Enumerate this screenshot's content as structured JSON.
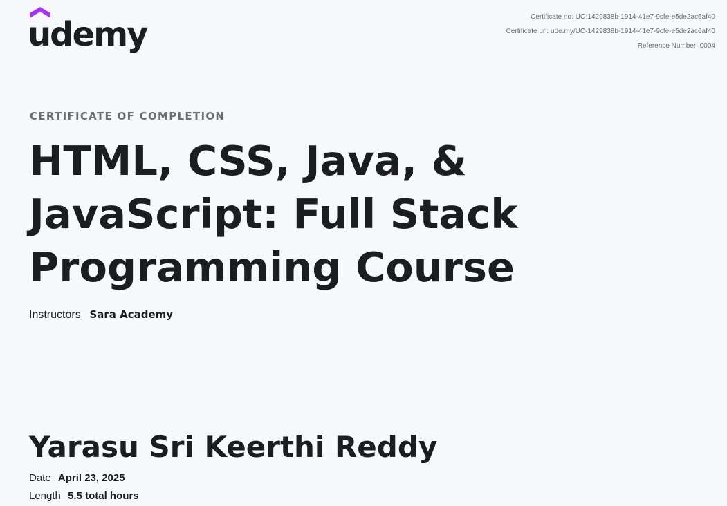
{
  "brand": {
    "name": "udemy",
    "accent_color": "#a435f0",
    "icon": "udemy-hat-icon"
  },
  "certificate_meta": {
    "number": "Certificate no: UC-1429838b-1914-41e7-9cfe-e5de2ac6af40",
    "url": "Certificate url: ude.my/UC-1429838b-1914-41e7-9cfe-e5de2ac6af40",
    "reference": "Reference Number: 0004"
  },
  "certificate": {
    "label": "CERTIFICATE OF COMPLETION",
    "course_title": "HTML, CSS, Java, & JavaScript: Full Stack Programming Course",
    "instructors_label": "Instructors",
    "instructors_value": "Sara Academy"
  },
  "recipient": {
    "name": "Yarasu Sri Keerthi Reddy"
  },
  "details": {
    "date_label": "Date",
    "date_value": "April 23, 2025",
    "length_label": "Length",
    "length_value": "5.5 total hours"
  }
}
